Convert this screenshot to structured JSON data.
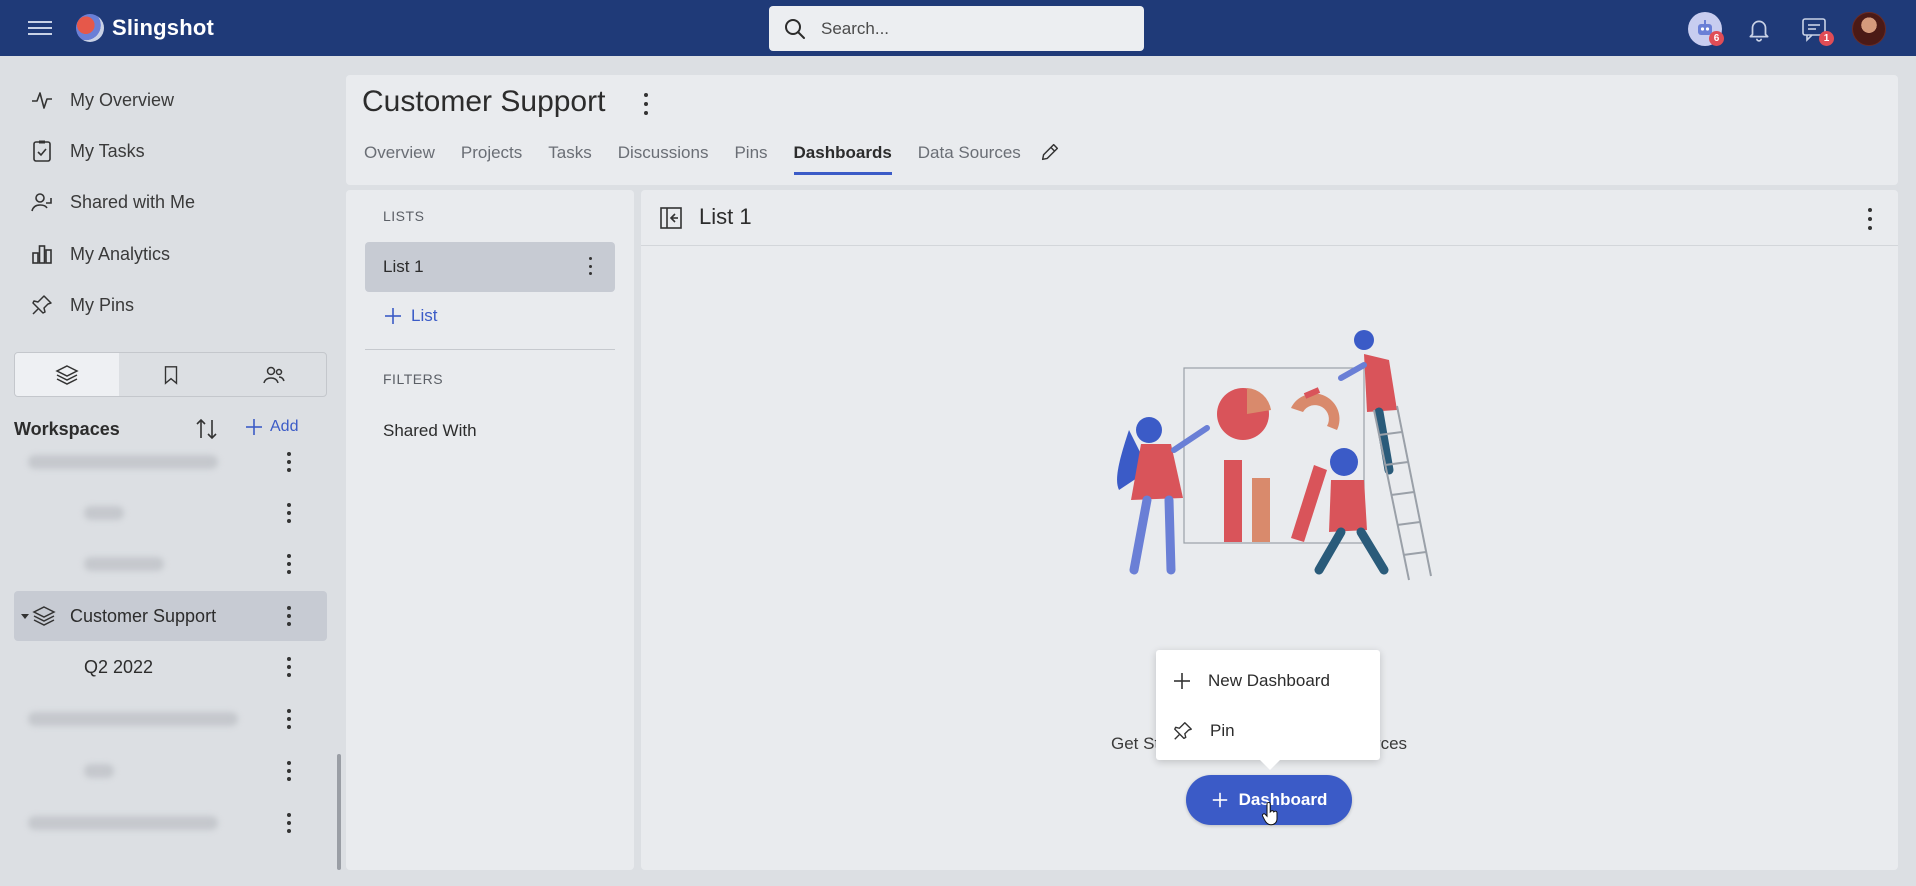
{
  "app": {
    "name": "Slingshot"
  },
  "search": {
    "placeholder": "Search..."
  },
  "header": {
    "bot_badge": "6",
    "messages_badge": "1"
  },
  "sidebar": {
    "nav": [
      {
        "label": "My Overview",
        "icon": "activity-icon"
      },
      {
        "label": "My Tasks",
        "icon": "task-icon"
      },
      {
        "label": "Shared with Me",
        "icon": "shared-user-icon"
      },
      {
        "label": "My Analytics",
        "icon": "bar-chart-icon"
      },
      {
        "label": "My Pins",
        "icon": "pin-icon"
      }
    ],
    "workspaces_title": "Workspaces",
    "add_label": "Add",
    "tree": [
      {
        "label": "Customer Support",
        "selected": true
      },
      {
        "label": "Q2 2022",
        "selected": false
      }
    ]
  },
  "workspace": {
    "title": "Customer Support",
    "tabs": [
      "Overview",
      "Projects",
      "Tasks",
      "Discussions",
      "Pins",
      "Dashboards",
      "Data Sources"
    ],
    "active_tab": "Dashboards"
  },
  "lists_panel": {
    "lists_label": "LISTS",
    "list_items": [
      "List 1"
    ],
    "add_list_label": "List",
    "filters_label": "FILTERS",
    "filters": [
      "Shared With"
    ]
  },
  "content": {
    "title": "List 1",
    "get_started_left": "Get St",
    "get_started_right": "ources",
    "dashboard_button": "Dashboard"
  },
  "popup": {
    "items": [
      {
        "label": "New Dashboard",
        "icon": "plus-icon"
      },
      {
        "label": "Pin",
        "icon": "pin-icon"
      }
    ]
  },
  "colors": {
    "topbar": "#1f3a78",
    "accent": "#3b5bc7",
    "badge": "#e04d56"
  }
}
